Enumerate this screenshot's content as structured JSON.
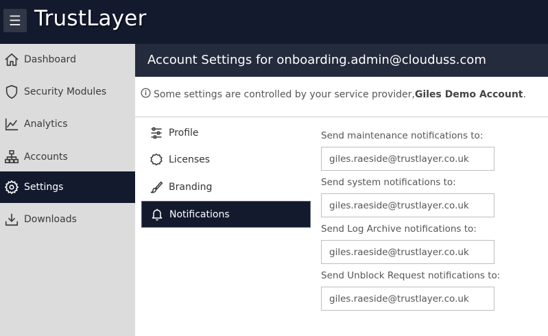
{
  "app": {
    "logo_text": "TrustLayer",
    "menu_icon": "hamburger-icon"
  },
  "colors": {
    "dark_navy": "#131a2e",
    "header_bg": "#242b3c",
    "sidebar_bg": "#dcdcdc"
  },
  "sidebar": {
    "items": [
      {
        "label": "Dashboard",
        "icon": "home-icon"
      },
      {
        "label": "Security Modules",
        "icon": "shield-icon"
      },
      {
        "label": "Analytics",
        "icon": "chart-icon"
      },
      {
        "label": "Accounts",
        "icon": "hierarchy-icon"
      },
      {
        "label": "Settings",
        "icon": "gear-icon",
        "active": true
      },
      {
        "label": "Downloads",
        "icon": "download-icon"
      }
    ]
  },
  "header": {
    "title": "Account Settings for onboarding.admin@clouduss.com"
  },
  "notice": {
    "text": "Some settings are controlled by your service provider, ",
    "provider": "Giles Demo Account",
    "suffix": "."
  },
  "settings_nav": {
    "items": [
      {
        "label": "Profile",
        "icon": "sliders-icon"
      },
      {
        "label": "Licenses",
        "icon": "badge-icon"
      },
      {
        "label": "Branding",
        "icon": "brush-icon"
      },
      {
        "label": "Notifications",
        "icon": "bell-icon",
        "active": true
      }
    ]
  },
  "form": {
    "fields": [
      {
        "label": "Send maintenance notifications to:",
        "value": "giles.raeside@trustlayer.co.uk"
      },
      {
        "label": "Send system notifications to:",
        "value": "giles.raeside@trustlayer.co.uk"
      },
      {
        "label": "Send Log Archive notifications to:",
        "value": "giles.raeside@trustlayer.co.uk"
      },
      {
        "label": "Send Unblock Request notifications to:",
        "value": "giles.raeside@trustlayer.co.uk"
      }
    ]
  }
}
